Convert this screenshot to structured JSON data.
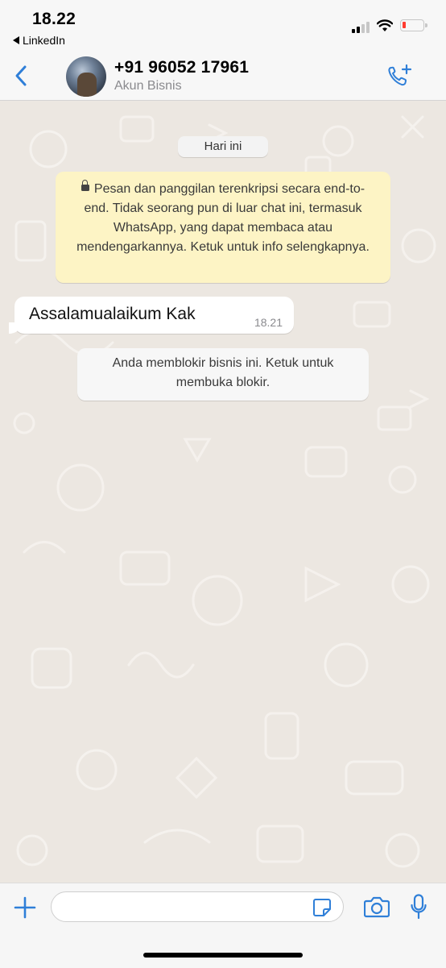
{
  "status_bar": {
    "time": "18.22",
    "back_app": "LinkedIn",
    "battery_color": "#ff3b30"
  },
  "header": {
    "contact_name": "+91 96052 17961",
    "subtitle": "Akun Bisnis",
    "accent_color": "#2f7fd8",
    "icons": {
      "back": "chevron-left-icon",
      "call": "phone-plus-icon"
    }
  },
  "chat": {
    "date_label": "Hari ini",
    "encryption_notice": "Pesan dan panggilan terenkripsi secara end-to-end. Tidak seorang pun di luar chat ini, termasuk WhatsApp, yang dapat membaca atau mendengarkannya. Ketuk untuk info selengkapnya.",
    "messages": [
      {
        "direction": "incoming",
        "text": "Assalamualaikum Kak",
        "time": "18.21"
      }
    ],
    "system_notice": "Anda memblokir bisnis ini. Ketuk untuk membuka blokir."
  },
  "input_bar": {
    "value": "",
    "icons": [
      "plus-icon",
      "sticker-icon",
      "camera-icon",
      "microphone-icon"
    ]
  }
}
